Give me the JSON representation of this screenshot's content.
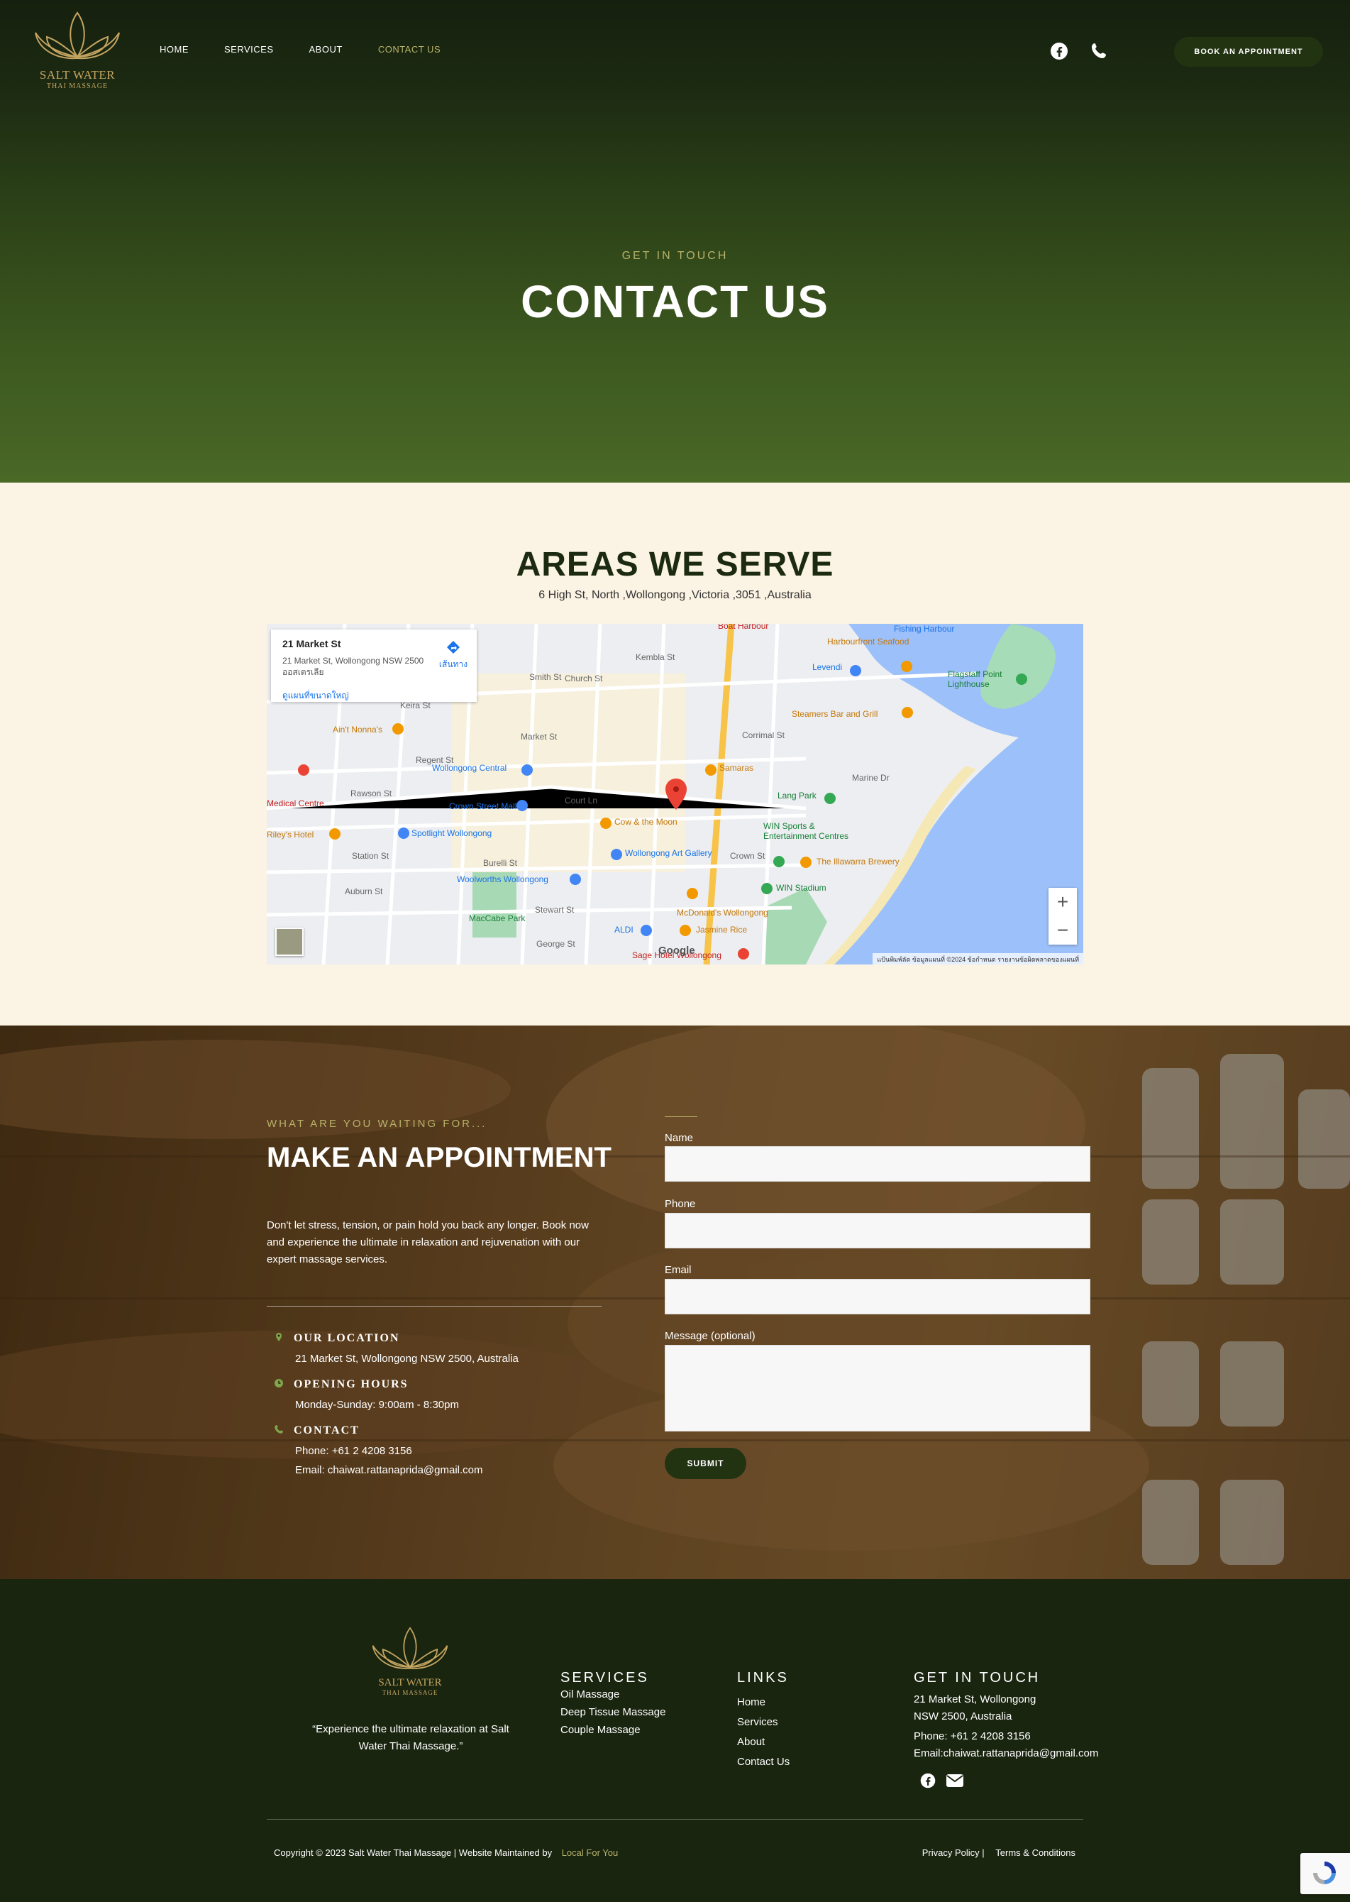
{
  "brand": {
    "name_line1": "SALT WATER",
    "name_line2": "THAI MASSAGE",
    "accent_color": "#b8b26a",
    "dark_green": "#223312"
  },
  "nav": {
    "items": [
      {
        "label": "HOME",
        "active": false
      },
      {
        "label": "SERVICES",
        "active": false
      },
      {
        "label": "ABOUT",
        "active": false
      },
      {
        "label": "CONTACT US",
        "active": true
      }
    ],
    "facebook_icon": "facebook-icon",
    "phone_icon": "phone-icon",
    "book_label": "BOOK AN APPOINTMENT"
  },
  "hero": {
    "eyebrow": "GET IN TOUCH",
    "title": "CONTACT US"
  },
  "areas": {
    "title": "AREAS WE SERVE",
    "address": "6 High St, North ,Wollongong ,Victoria ,3051 ,Australia",
    "map": {
      "card_title": "21 Market St",
      "card_address": "21 Market St, Wollongong NSW 2500 ออสเตรเลีย",
      "card_link": "ดูแผนที่ขนาดใหญ่",
      "directions_label": "เส้นทาง",
      "zoom_in": "+",
      "zoom_out": "−",
      "google_label": "Google",
      "footer_text": "แป้นพิมพ์ลัด   ข้อมูลแผนที่ ©2024   ข้อกำหนด   รายงานข้อผิดพลาดของแผนที่",
      "labels": [
        "Smith St",
        "Market St",
        "Wollongong Central",
        "Crown Street Mall",
        "Spotlight Wollongong",
        "Woolworths Wollongong",
        "MacCabe Park",
        "ALDI",
        "Samaras",
        "Cow & the Moon",
        "Wollongong Art Gallery",
        "McDonald's Wollongong",
        "Jasmine Rice",
        "Sage Hotel Wollongong",
        "Harbourfront Seafood",
        "Fishing Harbour",
        "Flagstaff Point Lighthouse",
        "Steamers Bar and Grill",
        "Lang Park",
        "WIN Sports & Entertainment Centres",
        "The Illawarra Brewery",
        "WIN Stadium",
        "Ain't Nonna's",
        "Riley's Hotel",
        "Medical Centre",
        "Burelli St",
        "Crown St",
        "Stewart St",
        "George St",
        "Keira St",
        "Kembla St",
        "Church St",
        "Rawson St",
        "Court Ln",
        "Levendi",
        "Boat Harbour",
        "Marine Dr",
        "Regent St",
        "Auburn St",
        "Station St",
        "Corrimal St"
      ]
    }
  },
  "appointment": {
    "eyebrow": "WHAT ARE YOU WAITING FOR...",
    "title": "MAKE AN APPOINTMENT",
    "description": "Don't let stress, tension, or pain hold you back any longer. Book now and experience the ultimate in relaxation and rejuvenation with our expert massage services.",
    "location_heading": "OUR LOCATION",
    "location_text": "21 Market St, Wollongong NSW 2500, Australia",
    "hours_heading": "OPENING HOURS",
    "hours_text": "Monday-Sunday: 9:00am - 8:30pm",
    "contact_heading": "CONTACT",
    "contact_phone": "Phone: +61 2 4208 3156",
    "contact_email": "Email: chaiwat.rattanaprida@gmail.com",
    "form": {
      "name_label": "Name",
      "phone_label": "Phone",
      "email_label": "Email",
      "message_label": "Message (optional)",
      "submit_label": "SUBMIT"
    }
  },
  "footer": {
    "quote": "“Experience the ultimate relaxation at Salt Water Thai Massage.”",
    "services_heading": "SERVICES",
    "services": [
      "Oil Massage",
      "Deep Tissue Massage",
      "Couple Massage"
    ],
    "links_heading": "LINKS",
    "links": [
      "Home",
      "Services",
      "About",
      "Contact Us"
    ],
    "contact_heading": "GET IN TOUCH",
    "address_line1": "21 Market St, Wollongong",
    "address_line2": "NSW 2500, Australia",
    "phone": "Phone: +61 2 4208 3156",
    "email": "Email:chaiwat.rattanaprida@gmail.com",
    "copyright": "Copyright © 2023 Salt Water Thai Massage | Website Maintained by",
    "maintainer": "Local For You",
    "privacy": "Privacy Policy |",
    "terms": "Terms & Conditions"
  }
}
